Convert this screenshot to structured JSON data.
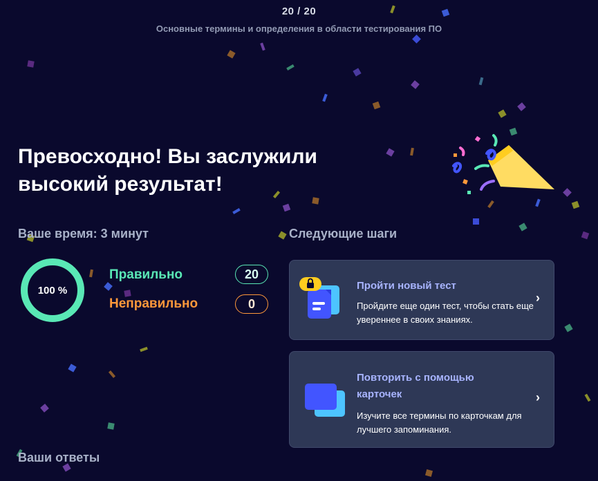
{
  "header": {
    "progress": "20 / 20",
    "set_title": "Основные термины и определения в области тестирования ПО"
  },
  "result": {
    "headline": "Превосходно! Вы заслужили высокий результат!",
    "time_label": "Ваше время: 3 минут",
    "percent": "100 %",
    "percent_value": 1.0,
    "correct_label": "Правильно",
    "correct_count": "20",
    "incorrect_label": "Неправильно",
    "incorrect_count": "0"
  },
  "next_steps": {
    "heading": "Следующие шаги",
    "cards": [
      {
        "title": "Пройти новый тест",
        "description": "Пройдите еще один тест, чтобы стать еще увереннее в своих знаниях.",
        "icon": "new-test-icon"
      },
      {
        "title": "Повторить с помощью карточек",
        "description": "Изучите все термины по карточкам для лучшего запоминания.",
        "icon": "flashcards-icon"
      }
    ]
  },
  "answers": {
    "heading": "Ваши ответы"
  },
  "colors": {
    "background": "#0a092d",
    "card": "#2e3856",
    "correct": "#59e8b5",
    "incorrect": "#ff983a",
    "accent": "#a8b4ff",
    "icon_blue": "#4255ff"
  }
}
